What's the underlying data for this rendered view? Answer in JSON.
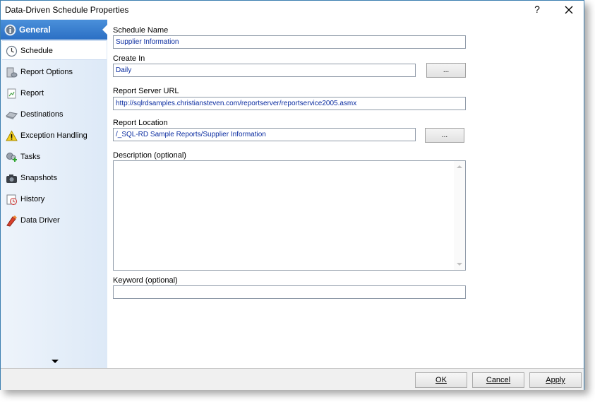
{
  "window": {
    "title": "Data-Driven Schedule Properties",
    "help_label": "?"
  },
  "sidebar": {
    "items": [
      {
        "label": "General",
        "icon": "info-icon"
      },
      {
        "label": "Schedule",
        "icon": "clock-icon"
      },
      {
        "label": "Report Options",
        "icon": "report-options-icon"
      },
      {
        "label": "Report",
        "icon": "report-icon"
      },
      {
        "label": "Destinations",
        "icon": "destinations-icon"
      },
      {
        "label": "Exception Handling",
        "icon": "warning-icon"
      },
      {
        "label": "Tasks",
        "icon": "tasks-icon"
      },
      {
        "label": "Snapshots",
        "icon": "camera-icon"
      },
      {
        "label": "History",
        "icon": "history-icon"
      },
      {
        "label": "Data Driver",
        "icon": "data-driver-icon"
      }
    ]
  },
  "form": {
    "schedule_name": {
      "label": "Schedule Name",
      "value": "Supplier Information"
    },
    "create_in": {
      "label": "Create In",
      "value": "Daily",
      "browse_label": "..."
    },
    "report_server_url": {
      "label": "Report Server URL",
      "value": "http://sqlrdsamples.christiansteven.com/reportserver/reportservice2005.asmx"
    },
    "report_location": {
      "label": "Report Location",
      "value": "/_SQL-RD Sample Reports/Supplier Information",
      "browse_label": "..."
    },
    "description": {
      "label": "Description (optional)",
      "value": ""
    },
    "keyword": {
      "label": "Keyword (optional)",
      "value": ""
    }
  },
  "footer": {
    "ok_label": "OK",
    "cancel_label": "Cancel",
    "apply_label": "Apply"
  },
  "colors": {
    "active_nav": "#2b6fc4",
    "field_text": "#0a2ca0",
    "window_border": "#3c7fb1"
  }
}
